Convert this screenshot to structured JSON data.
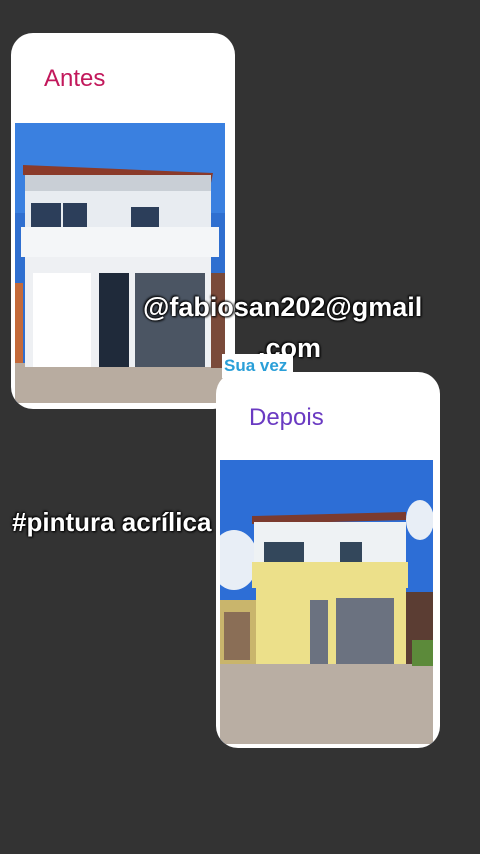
{
  "cards": {
    "before": {
      "title": "Antes"
    },
    "after": {
      "title": "Depois"
    }
  },
  "overlay": {
    "email_line1": "@fabiosan202@gmail",
    "email_line2": ".com",
    "hashtag": "#pintura acrílica",
    "sticker": "Sua vez"
  },
  "colors": {
    "background": "#333333",
    "antes_title": "#c2185b",
    "depois_title": "#6a3ac2",
    "sticker_text": "#2a9fd8"
  }
}
